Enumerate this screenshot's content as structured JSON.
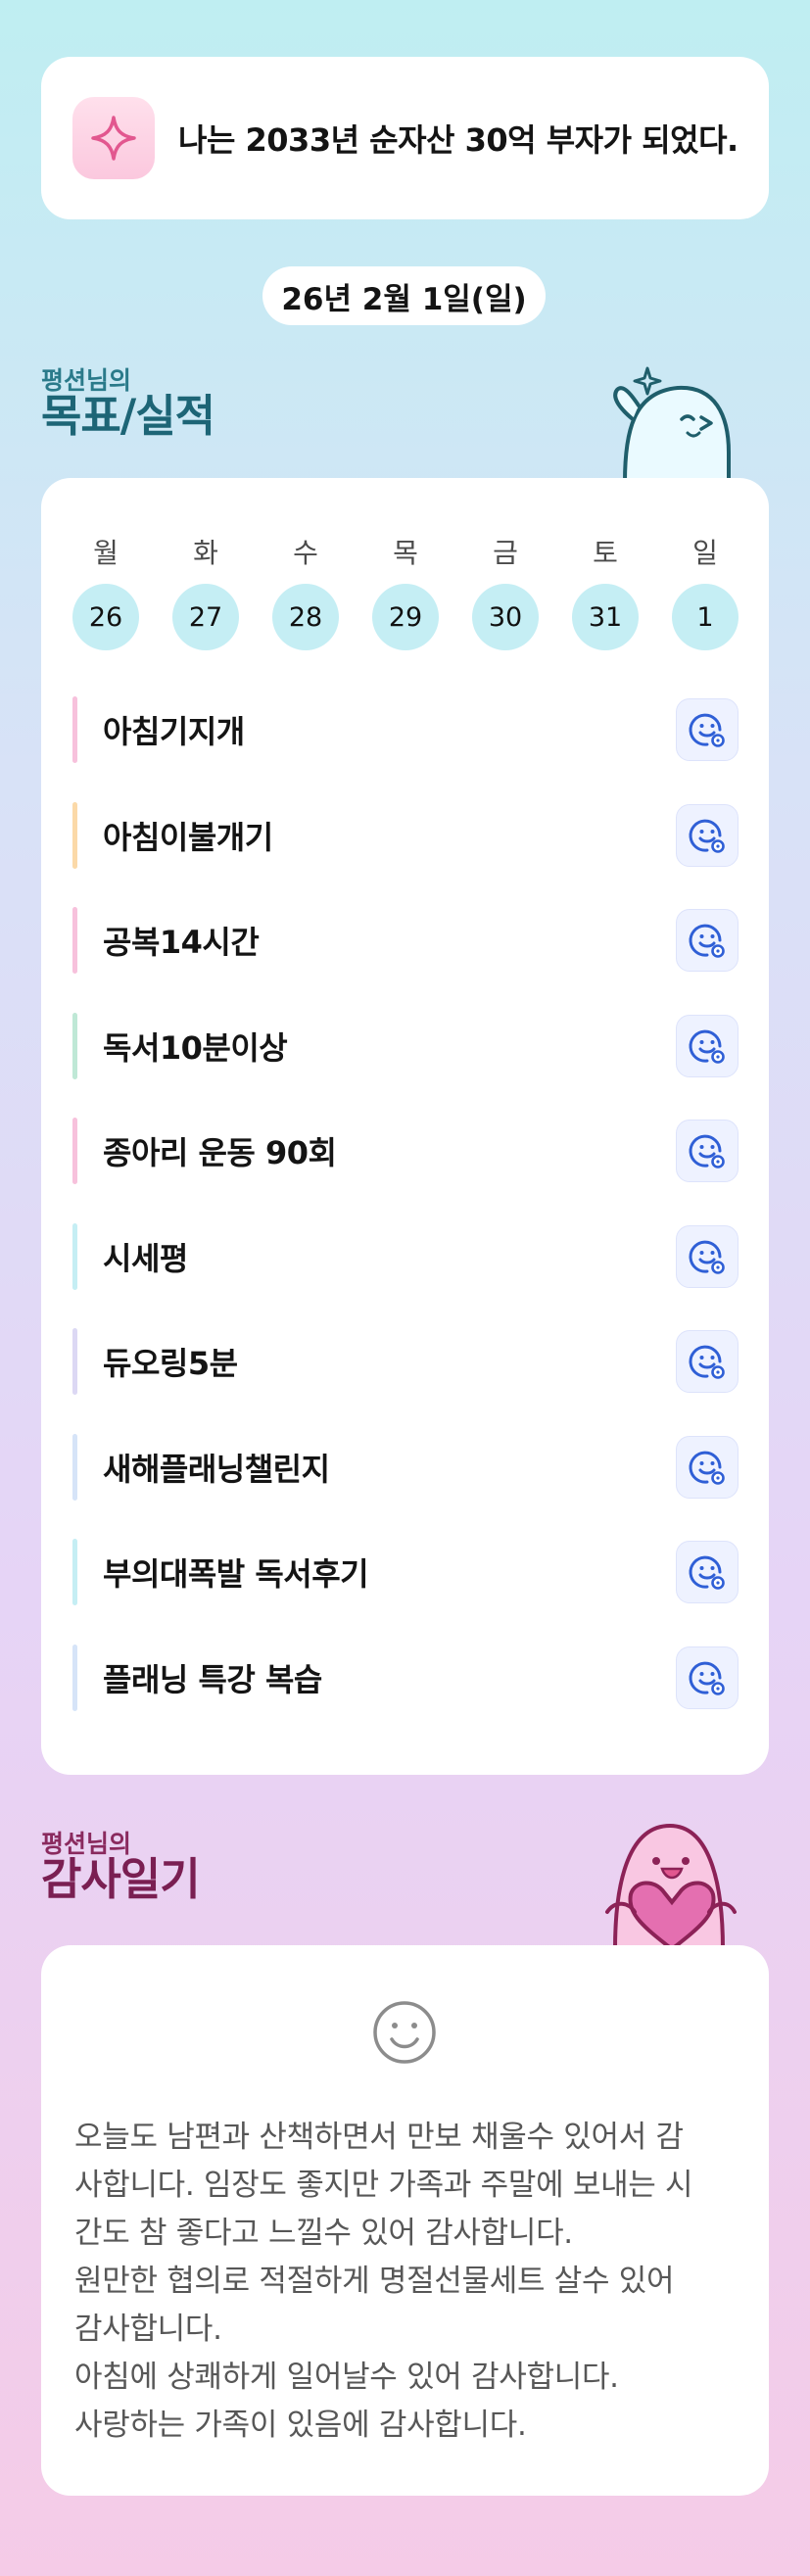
{
  "goal_banner": {
    "icon": "sparkle-icon",
    "text": "나는 2033년 순자산 30억 부자가 되었다."
  },
  "date_label": "26년 2월 1일(일)",
  "record_section": {
    "title_small": "평션님의",
    "title_big": "목표/실적"
  },
  "calendar": {
    "weekdays": [
      "월",
      "화",
      "수",
      "목",
      "금",
      "토",
      "일"
    ],
    "dates": [
      "26",
      "27",
      "28",
      "29",
      "30",
      "31",
      "1"
    ]
  },
  "goals": [
    {
      "label": "아침기지개",
      "color": "#f7c1dc",
      "icon": "smiley-add-icon"
    },
    {
      "label": "아침이불개기",
      "color": "#fbd9a8",
      "icon": "smiley-add-icon"
    },
    {
      "label": "공복14시간",
      "color": "#f7c1dc",
      "icon": "smiley-add-icon"
    },
    {
      "label": "독서10분이상",
      "color": "#bfe8d6",
      "icon": "smiley-add-icon"
    },
    {
      "label": "종아리 운동 90회",
      "color": "#f7c1dc",
      "icon": "smiley-add-icon"
    },
    {
      "label": "시세평",
      "color": "#c5eef4",
      "icon": "smiley-add-icon"
    },
    {
      "label": "듀오링5분",
      "color": "#dcd8f4",
      "icon": "smiley-add-icon"
    },
    {
      "label": "새해플래닝챌린지",
      "color": "#d6e4f8",
      "icon": "smiley-add-icon"
    },
    {
      "label": "부의대폭발 독서후기",
      "color": "#c5eef4",
      "icon": "smiley-add-icon"
    },
    {
      "label": "플래닝 특강 복습",
      "color": "#d6e4f8",
      "icon": "smiley-add-icon"
    }
  ],
  "gratitude_section": {
    "title_small": "평션님의",
    "title_big": "감사일기",
    "icon": "smiley-icon",
    "lines": [
      "오늘도 남편과 산책하면서 만보 채울수 있어서 감",
      "사합니다. 임장도 좋지만 가족과 주말에 보내는 시",
      "간도 참 좋다고 느낄수 있어 감사합니다.",
      "원만한 협의로 적절하게 명절선물세트 살수 있어",
      "감사합니다.",
      "아침에 상쾌하게 일어날수 있어 감사합니다.",
      "사랑하는 가족이 있음에 감사합니다."
    ]
  },
  "colors": {
    "accent_blue": "#2f5fd6",
    "date_circle": "#c5eef4",
    "record_title": "#1d6576",
    "gratitude_title": "#7a1f52"
  }
}
